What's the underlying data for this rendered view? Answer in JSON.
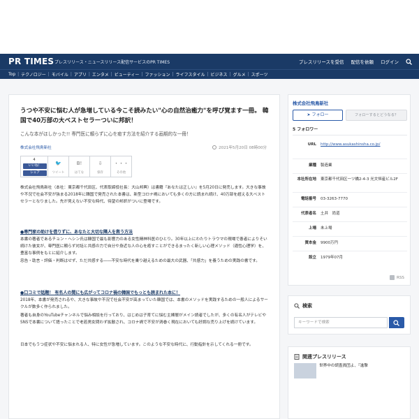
{
  "header": {
    "logo": "PR TIMES",
    "tagline": "プレスリリース・ニュースリリース配信サービスのPR TIMES",
    "nav": [
      "プレスリリースを受信",
      "配信を依頼",
      "ログイン"
    ]
  },
  "categories": [
    "Top",
    "テクノロジー",
    "モバイル",
    "アプリ",
    "エンタメ",
    "ビューティー",
    "ファッション",
    "ライフスタイル",
    "ビジネス",
    "グルメ",
    "スポーツ"
  ],
  "article": {
    "headline": "うつや不安に悩む人が急増している今こそ読みたい\"心の自然治癒力\"を呼び覚ます一冊。 韓国で40万部の大ベストセラーついに邦訳！",
    "subhead": "こんな本がほしかった!! 専門医に頼らずに心を癒す方法を紹介する画期的な一冊！",
    "company": "株式会社飛鳥新社",
    "date": "2021年5月20日 08時00分",
    "share": {
      "count": "4",
      "like": "いいね！",
      "share": "シェア",
      "buttons": [
        {
          "icon": "twitter-icon",
          "glyph": "🐦",
          "label": "ツイート"
        },
        {
          "icon": "hatena-icon",
          "glyph": "B!",
          "label": "はてな"
        },
        {
          "icon": "save-icon",
          "glyph": "⇩",
          "label": "保存"
        },
        {
          "icon": "more-icon",
          "glyph": "・・・",
          "label": "その他"
        }
      ]
    },
    "intro": "株式会社飛鳥新社（本社：東京都千代田区、代表取締役社長：大山邦興）は書籍『あなたは正しい』を5月20日に発売します。大きな事故や不況で社会不安が強まる2018年に韓国で発売された本書は、新型コロナ禍においても多くの方に読まれ続け、40万部を超える大ベストセラーとなりました。先が見えない不安な時代、待望の邦訳がついに登場です。",
    "section1_title": "●専門家の助けを借りずに、あなたと大切な隣人を救う方法",
    "section1_body": "本書の著者であるチョン・ヘシン氏は韓国で最も影響力のある女性精神科医のひとり。30年以上にわたりトラウマの現場で患者によりそい続けた彼女が、専門医に頼らず対話と共感の力で自分や身近な人の心を癒すことができるまったく新しい心理メソッド（適性心理学）を、豊富な事例をもとに紹介します。",
    "section1_body2": "忠告・助言・評価・判断はせず、ただ共感する――不安な時代を乗り越えるための最大の武器、「共感力」を養うための実践の書です。",
    "section2_title": "●口コミで話題！ 有名人の間にも広がってコロナ禍の韓国でもっとも読まれた本に！",
    "section2_body": "2018年、本書が発売されるや、大きな事故や不況で社会不安が高まっていた韓国では、本書のメソッドを実践するための一般人によるサークルが数多く作られました。",
    "section2_body2": "著者も自身のYouTubeチャンネルで悩み相談を行っており、はじめは子育てに悩む主婦層がメイン読者でしたが、多くの有名人がテレビやSNSで本書について語ったことで老若男女問わず拡散され、コロナ禍で不安が渦巻く現在においても好調な売り上げを続けています。",
    "section2_body3": "日本でもうつ症状や不安に悩まれる人、特に女性が急増しています。このような不安な時代に、行動指針を示してくれる一冊です。"
  },
  "sidebar": {
    "company": "株式会社飛鳥新社",
    "follow": "フォロー",
    "follow_hint": "フォローするとどうなる？",
    "followers": "5 フォロワー",
    "info": [
      {
        "key": "URL",
        "value": "http://www.asukashinsha.co.jp/",
        "link": true
      },
      {
        "key": "業種",
        "value": "製造業"
      },
      {
        "key": "本社所在地",
        "value": "東京都千代田区一ツ橋2-4-3 光文恒産ビル2F"
      },
      {
        "key": "電話番号",
        "value": "03-3263-7770"
      },
      {
        "key": "代表者名",
        "value": "土井　尚道"
      },
      {
        "key": "上場",
        "value": "未上場"
      },
      {
        "key": "資本金",
        "value": "9900万円"
      },
      {
        "key": "設立",
        "value": "1979年07月"
      }
    ],
    "rss": "RSS"
  },
  "search": {
    "title": "検索",
    "placeholder": "キーワードで検索"
  },
  "related": {
    "title": "関連プレスリリース",
    "item_text": "世界中の調査員団よ、『進撃"
  }
}
